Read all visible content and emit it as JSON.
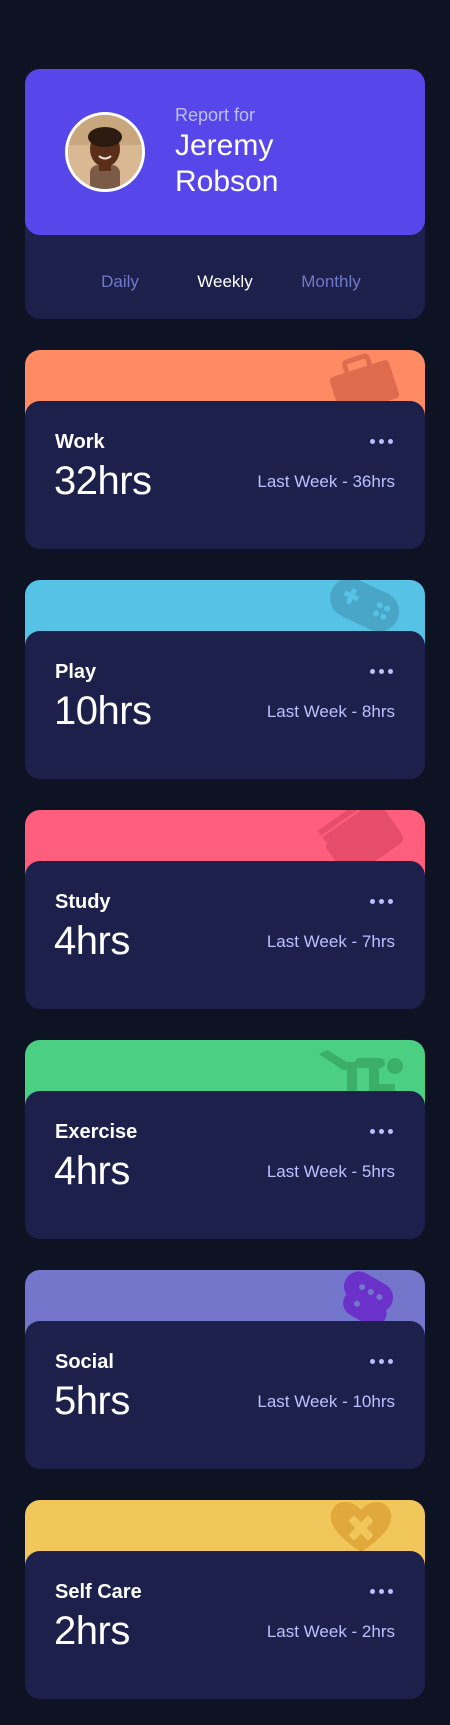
{
  "profile": {
    "report_for": "Report for",
    "name": "Jeremy Robson",
    "accent_color": "#5747ea"
  },
  "tabs": [
    {
      "label": "Daily",
      "active": false
    },
    {
      "label": "Weekly",
      "active": true
    },
    {
      "label": "Monthly",
      "active": false
    }
  ],
  "activities": [
    {
      "title": "Work",
      "current": "32hrs",
      "previous": "Last Week - 36hrs",
      "color": "#ff8b64",
      "icon": "briefcase-icon"
    },
    {
      "title": "Play",
      "current": "10hrs",
      "previous": "Last Week - 8hrs",
      "color": "#55c2e6",
      "icon": "gamepad-icon"
    },
    {
      "title": "Study",
      "current": "4hrs",
      "previous": "Last Week - 7hrs",
      "color": "#ff5e7d",
      "icon": "books-icon"
    },
    {
      "title": "Exercise",
      "current": "4hrs",
      "previous": "Last Week - 5hrs",
      "color": "#4bcf82",
      "icon": "running-person-icon"
    },
    {
      "title": "Social",
      "current": "5hrs",
      "previous": "Last Week - 10hrs",
      "color": "#7335d2",
      "icon": "chat-bubbles-icon"
    },
    {
      "title": "Self Care",
      "current": "2hrs",
      "previous": "Last Week - 2hrs",
      "color": "#f1c75b",
      "icon": "heart-bandage-icon"
    }
  ]
}
